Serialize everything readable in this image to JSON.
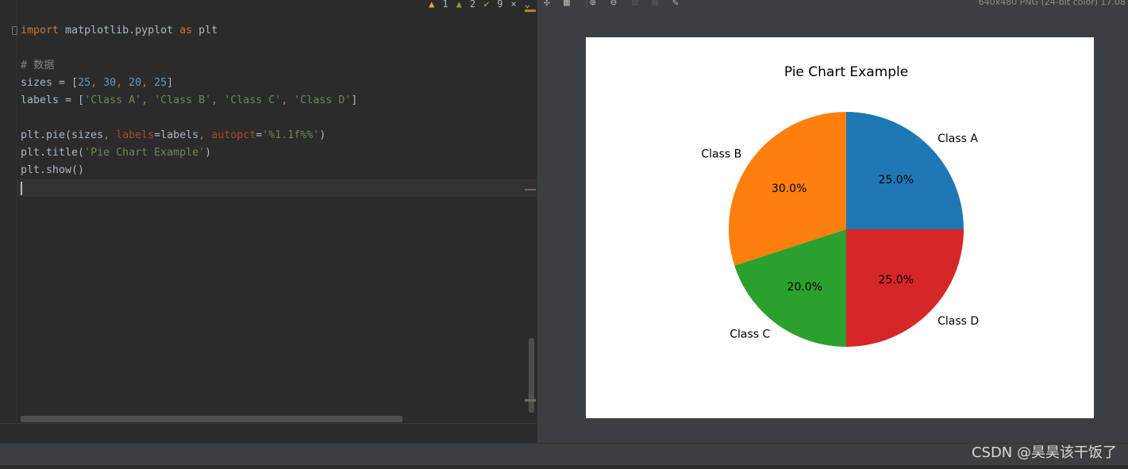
{
  "editor": {
    "inspections": {
      "errors": "1",
      "warnings": "2",
      "typos": "9"
    },
    "lines": [
      [
        [
          "kw",
          "import"
        ],
        [
          "txt",
          " matplotlib.pyplot "
        ],
        [
          "kw",
          "as"
        ],
        [
          "txt",
          " plt"
        ]
      ],
      [],
      [
        [
          "cmt",
          "# 数据"
        ]
      ],
      [
        [
          "txt",
          "sizes = ["
        ],
        [
          "num",
          "25"
        ],
        [
          "kw",
          ", "
        ],
        [
          "num",
          "30"
        ],
        [
          "kw",
          ", "
        ],
        [
          "num",
          "20"
        ],
        [
          "kw",
          ", "
        ],
        [
          "num",
          "25"
        ],
        [
          "txt",
          "]"
        ]
      ],
      [
        [
          "txt",
          "labels = ["
        ],
        [
          "str",
          "'Class A'"
        ],
        [
          "kw",
          ", "
        ],
        [
          "str",
          "'Class B'"
        ],
        [
          "kw",
          ", "
        ],
        [
          "str",
          "'Class C'"
        ],
        [
          "kw",
          ", "
        ],
        [
          "str",
          "'Class D'"
        ],
        [
          "txt",
          "]"
        ]
      ],
      [],
      [
        [
          "txt",
          "plt.pie(sizes"
        ],
        [
          "kw",
          ", "
        ],
        [
          "param",
          "labels"
        ],
        [
          "txt",
          "=labels"
        ],
        [
          "kw",
          ", "
        ],
        [
          "param",
          "autopct"
        ],
        [
          "txt",
          "="
        ],
        [
          "str",
          "'%1.1f%%'"
        ],
        [
          "txt",
          ")"
        ]
      ],
      [
        [
          "txt",
          "plt.title("
        ],
        [
          "str",
          "'Pie Chart Example'"
        ],
        [
          "txt",
          ")"
        ]
      ],
      [
        [
          "txt",
          "plt.show()"
        ]
      ],
      []
    ]
  },
  "viewer": {
    "image_info": "640x480 PNG (24-bit color) 17.08"
  },
  "watermark": "CSDN @昊昊该干饭了",
  "chart_data": {
    "type": "pie",
    "title": "Pie Chart Example",
    "categories": [
      "Class A",
      "Class B",
      "Class C",
      "Class D"
    ],
    "values": [
      25,
      30,
      20,
      25
    ],
    "value_labels": [
      "25.0%",
      "30.0%",
      "20.0%",
      "25.0%"
    ],
    "colors": [
      "#1f77b4",
      "#ff7f0e",
      "#2ca02c",
      "#d62728"
    ],
    "start_angle": 0,
    "direction": "counterclockwise"
  }
}
